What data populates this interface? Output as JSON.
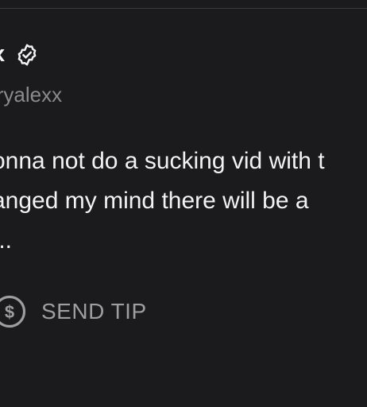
{
  "post": {
    "author": {
      "display_name": "x",
      "handle": "iryalexx",
      "verified_icon": "verified-check-icon"
    },
    "text_lines": [
      "onna not do a sucking vid with t",
      "anged my mind there will be a",
      "..."
    ],
    "actions": {
      "tip_label": "SEND TIP",
      "tip_icon": "dollar-circle-icon"
    }
  },
  "colors": {
    "background": "#1b1b1d",
    "text": "#f2f2f2",
    "muted": "#8a8a8f",
    "divider": "#3a3a3d"
  }
}
